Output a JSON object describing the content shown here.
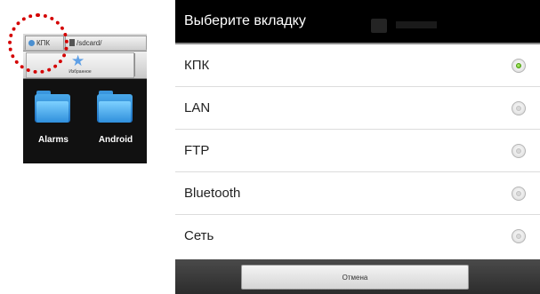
{
  "file_manager": {
    "tabs": [
      {
        "label": "КПК",
        "icon": "device-icon"
      },
      {
        "label": "/sdcard/",
        "icon": "sdcard-icon"
      }
    ],
    "toolbar": {
      "favorites_label": "Избранное",
      "favorites_icon": "star-icon"
    },
    "folders": [
      {
        "name": "Alarms",
        "icon": "folder-icon"
      },
      {
        "name": "Android",
        "icon": "folder-icon"
      }
    ],
    "highlight_color": "#d40000"
  },
  "dialog": {
    "title": "Выберите вкладку",
    "options": [
      {
        "label": "КПК",
        "selected": true
      },
      {
        "label": "LAN",
        "selected": false
      },
      {
        "label": "FTP",
        "selected": false
      },
      {
        "label": "Bluetooth",
        "selected": false
      },
      {
        "label": "Сеть",
        "selected": false
      }
    ],
    "cancel_label": "Отмена",
    "accent_color": "#59b512"
  }
}
